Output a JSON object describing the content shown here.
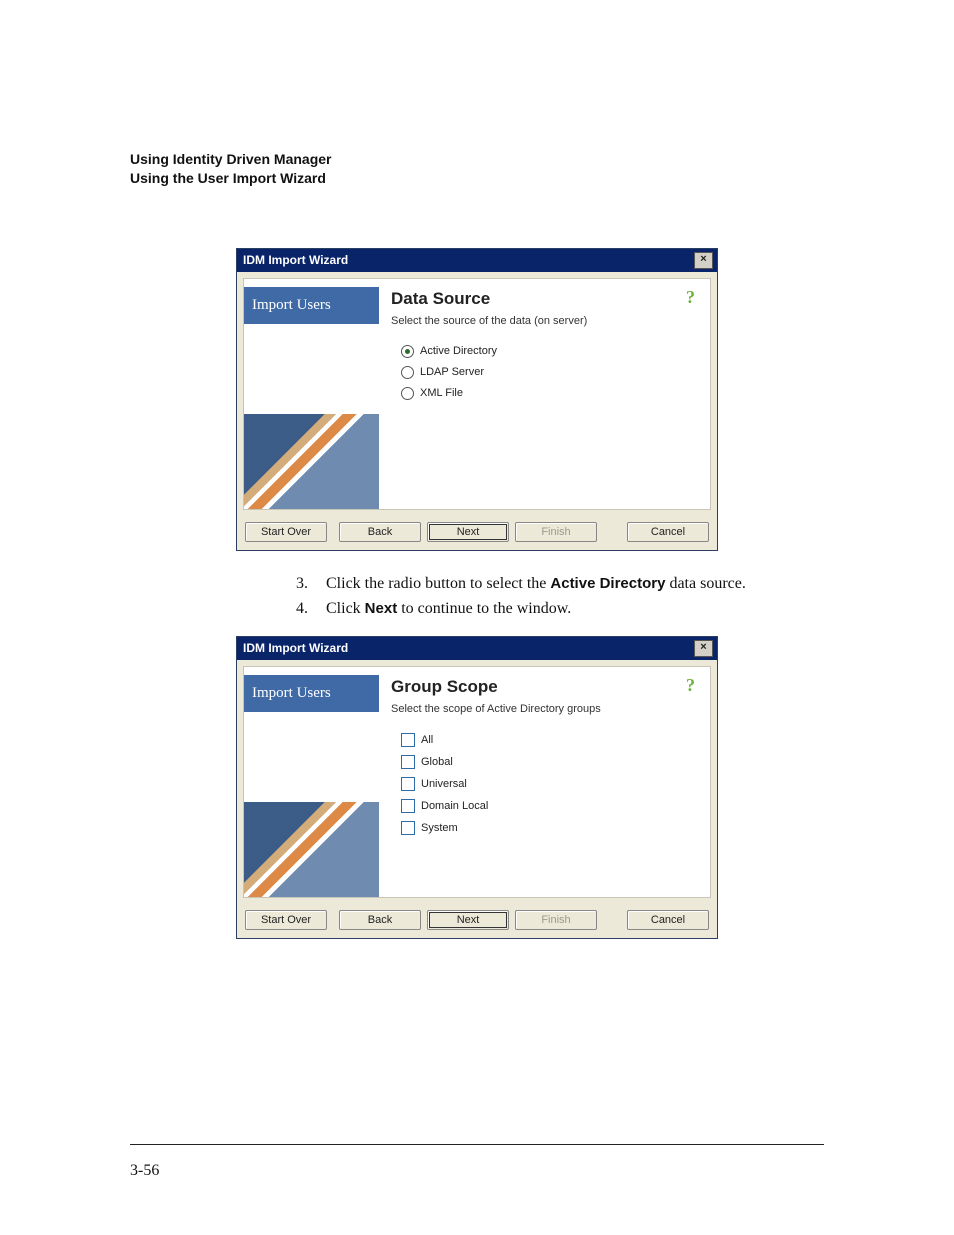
{
  "header": {
    "line1": "Using Identity Driven Manager",
    "line2": "Using the User Import Wizard"
  },
  "dialog1": {
    "title": "IDM Import Wizard",
    "left_label": "Import Users",
    "heading": "Data Source",
    "sub": "Select the source of the data (on server)",
    "options": [
      {
        "label": "Active Directory",
        "selected": true
      },
      {
        "label": "LDAP Server",
        "selected": false
      },
      {
        "label": "XML File",
        "selected": false
      }
    ],
    "buttons": {
      "start": "Start Over",
      "back": "Back",
      "next": "Next",
      "finish": "Finish",
      "cancel": "Cancel"
    }
  },
  "steps": {
    "s3_pre": "Click the radio button to select the ",
    "s3_bold": "Active Directory",
    "s3_post": " data source.",
    "s4_pre": "Click ",
    "s4_bold": "Next",
    "s4_post": " to continue to the                     window."
  },
  "dialog2": {
    "title": "IDM Import Wizard",
    "left_label": "Import Users",
    "heading": "Group Scope",
    "sub": "Select the scope of Active Directory groups",
    "options": [
      {
        "label": "All"
      },
      {
        "label": "Global"
      },
      {
        "label": "Universal"
      },
      {
        "label": "Domain Local"
      },
      {
        "label": "System"
      }
    ],
    "buttons": {
      "start": "Start Over",
      "back": "Back",
      "next": "Next",
      "finish": "Finish",
      "cancel": "Cancel"
    }
  },
  "page_number": "3-56"
}
